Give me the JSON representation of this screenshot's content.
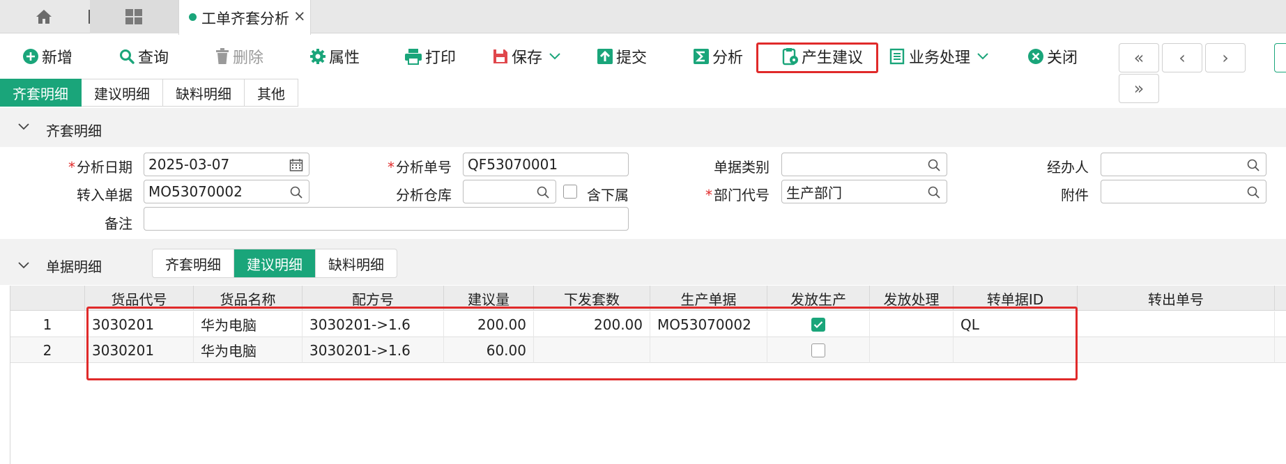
{
  "tabs": {
    "home_icon": "home-icon",
    "grid_icon": "grid-icon",
    "document_tab": "工单齐套分析",
    "close": "×"
  },
  "toolbar": {
    "new": "新增",
    "query": "查询",
    "delete": "删除",
    "properties": "属性",
    "print": "打印",
    "save": "保存",
    "submit": "提交",
    "analyze": "分析",
    "generate_suggestion": "产生建议",
    "business": "业务处理",
    "close": "关闭",
    "nav": {
      "first": "«",
      "prev": "‹",
      "next": "›",
      "last": "»"
    },
    "accent_color": "#1aa57a",
    "highlight_color": "#e02a2a"
  },
  "subtabs": [
    "齐套明细",
    "建议明细",
    "缺料明细",
    "其他"
  ],
  "section1": {
    "title": "齐套明细"
  },
  "form": {
    "analysis_date": {
      "label": "分析日期",
      "value": "2025-03-07"
    },
    "analysis_no": {
      "label": "分析单号",
      "value": "QF53070001"
    },
    "doc_type": {
      "label": "单据类别",
      "value": ""
    },
    "handler": {
      "label": "经办人",
      "value": ""
    },
    "source_doc": {
      "label": "转入单据",
      "value": "MO53070002"
    },
    "warehouse": {
      "label": "分析仓库",
      "value": ""
    },
    "include_sub": {
      "label": "含下属",
      "checked": false
    },
    "dept_code": {
      "label": "部门代号",
      "value": "生产部门"
    },
    "attachment": {
      "label": "附件",
      "value": ""
    },
    "remark": {
      "label": "备注",
      "value": ""
    }
  },
  "section2": {
    "title": "单据明细"
  },
  "detail_tabs": [
    "齐套明细",
    "建议明细",
    "缺料明细"
  ],
  "table": {
    "columns": [
      "货品代号",
      "货品名称",
      "配方号",
      "建议量",
      "下发套数",
      "生产单据",
      "发放生产",
      "发放处理",
      "转单据ID",
      "转出单号"
    ],
    "rows": [
      {
        "idx": "1",
        "code": "3030201",
        "name": "华为电脑",
        "recipe": "3030201->1.6",
        "qty": "200.00",
        "sets": "200.00",
        "prod_doc": "MO53070002",
        "issued": true,
        "handling": "",
        "trans_id": "QL",
        "out_no": ""
      },
      {
        "idx": "2",
        "code": "3030201",
        "name": "华为电脑",
        "recipe": "3030201->1.6",
        "qty": "60.00",
        "sets": "",
        "prod_doc": "",
        "issued": false,
        "handling": "",
        "trans_id": "",
        "out_no": ""
      }
    ]
  }
}
